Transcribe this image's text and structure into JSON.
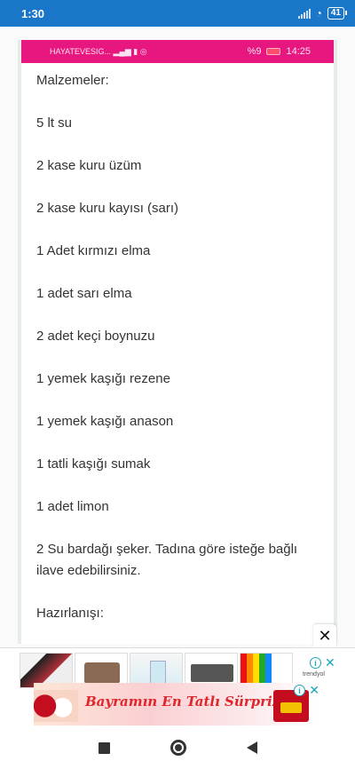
{
  "status_bar": {
    "time": "1:30",
    "battery": "41"
  },
  "inner_status": {
    "carrier": "HAYATEVESIG...",
    "battery_percent": "%9",
    "time": "14:25"
  },
  "content": {
    "heading": "Malzemeler:",
    "items": [
      "5 lt su",
      "2  kase kuru üzüm",
      "2  kase kuru kayısı (sarı)",
      "1 Adet kırmızı elma",
      "1 adet sarı elma",
      "2 adet keçi boynuzu",
      "1 yemek kaşığı rezene",
      "1 yemek kaşığı anason",
      "1 tatli kaşığı sumak",
      "1 adet limon",
      "2 Su bardağı şeker.  Tadına göre isteğe bağlı ilave edebilirsiniz."
    ],
    "section2": "Hazırlanışı:"
  },
  "ad": {
    "close_label": "✕",
    "banner_text": "Bayramın En Tatlı Sürprizi",
    "brand": "trendyol"
  },
  "colors": {
    "status_bar": "#1a76c9",
    "inner_status": "#e8167f",
    "ad_accent": "#1aa6b7"
  }
}
